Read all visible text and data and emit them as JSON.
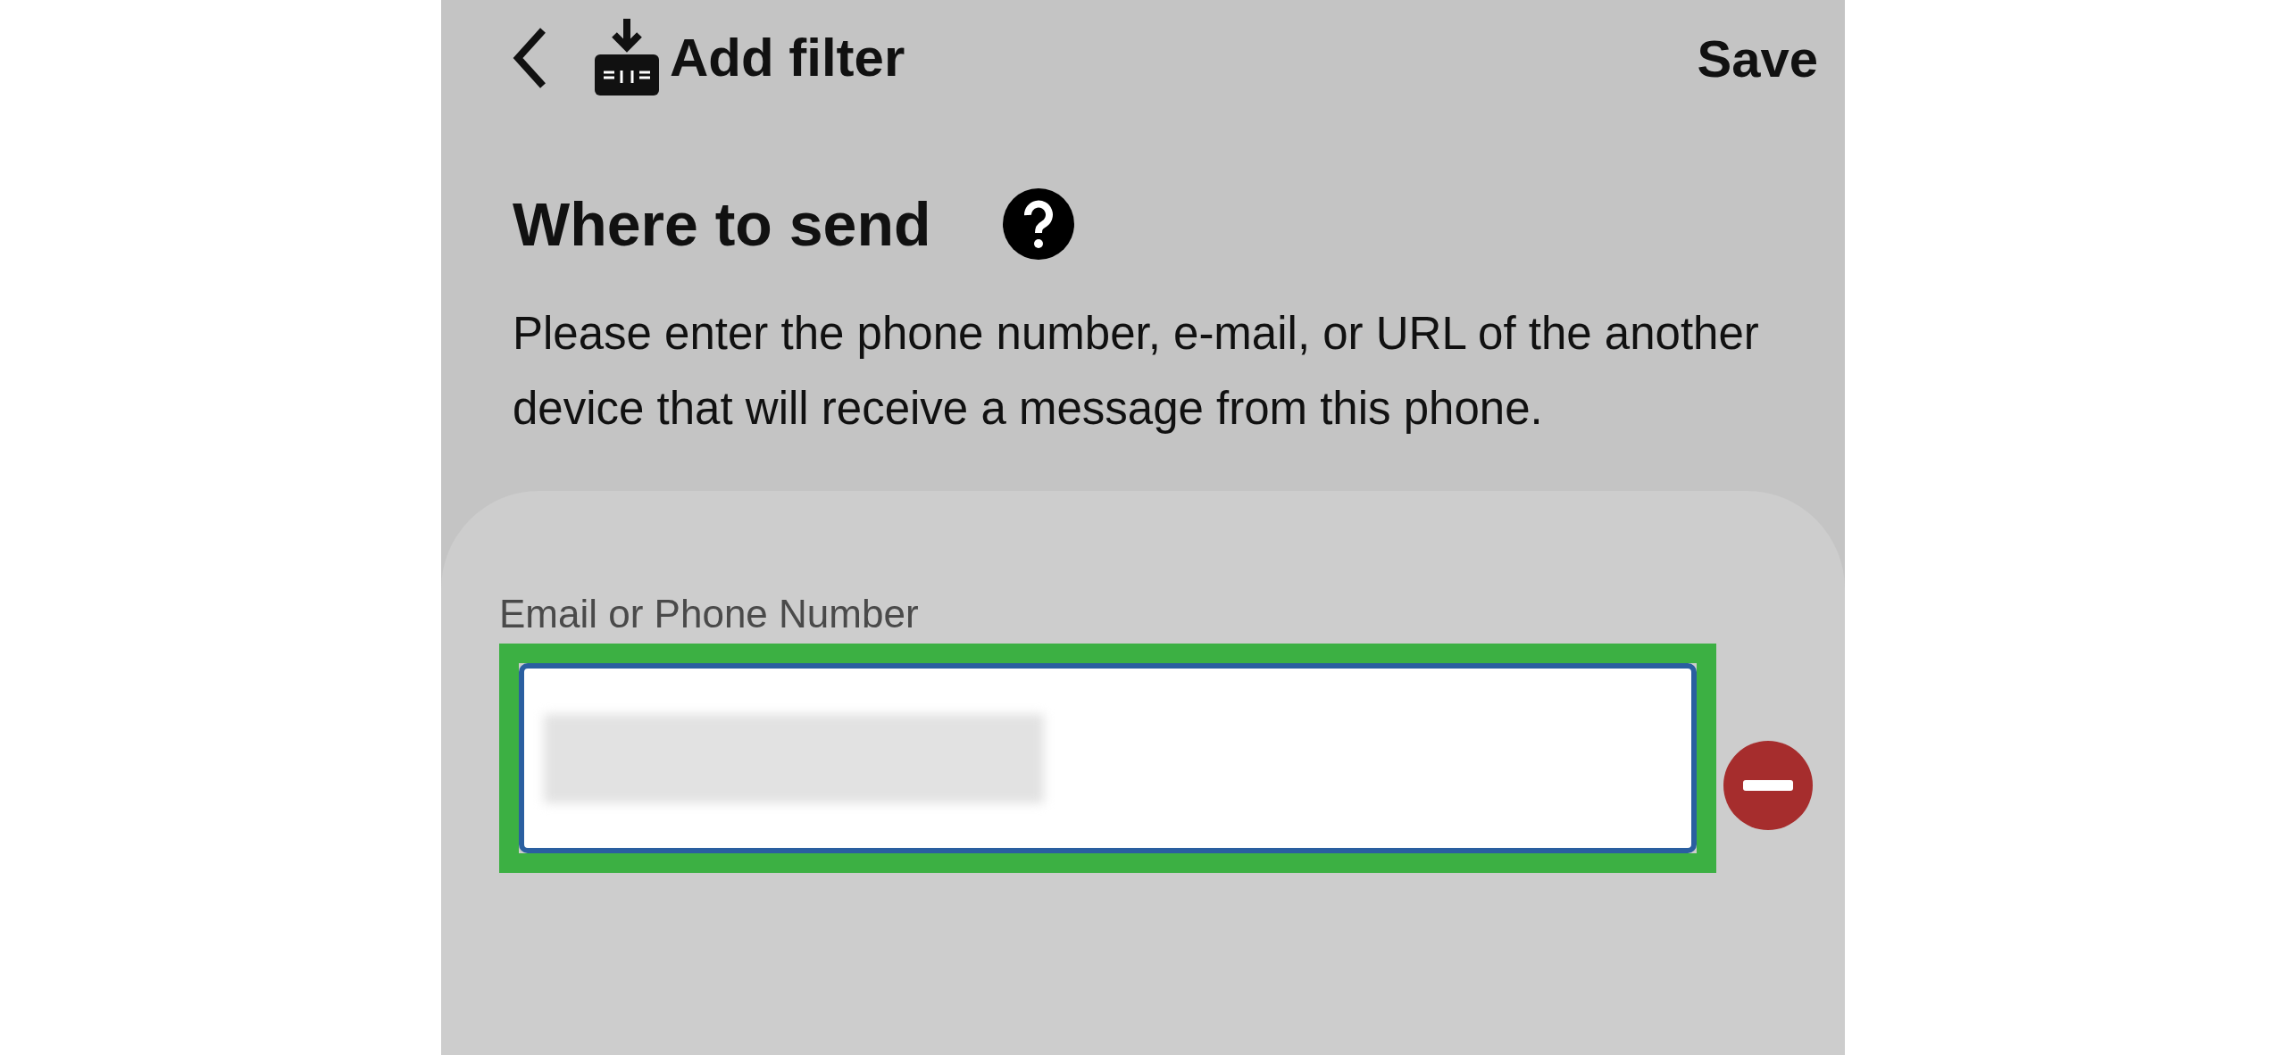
{
  "header": {
    "title": "Add filter",
    "save": "Save"
  },
  "section": {
    "title": "Where to send",
    "description": "Please enter the phone number, e-mail, or URL of the another device that will receive a message from this phone."
  },
  "field": {
    "label": "Email or Phone Number",
    "highlighted": true,
    "value_blurred": true
  }
}
